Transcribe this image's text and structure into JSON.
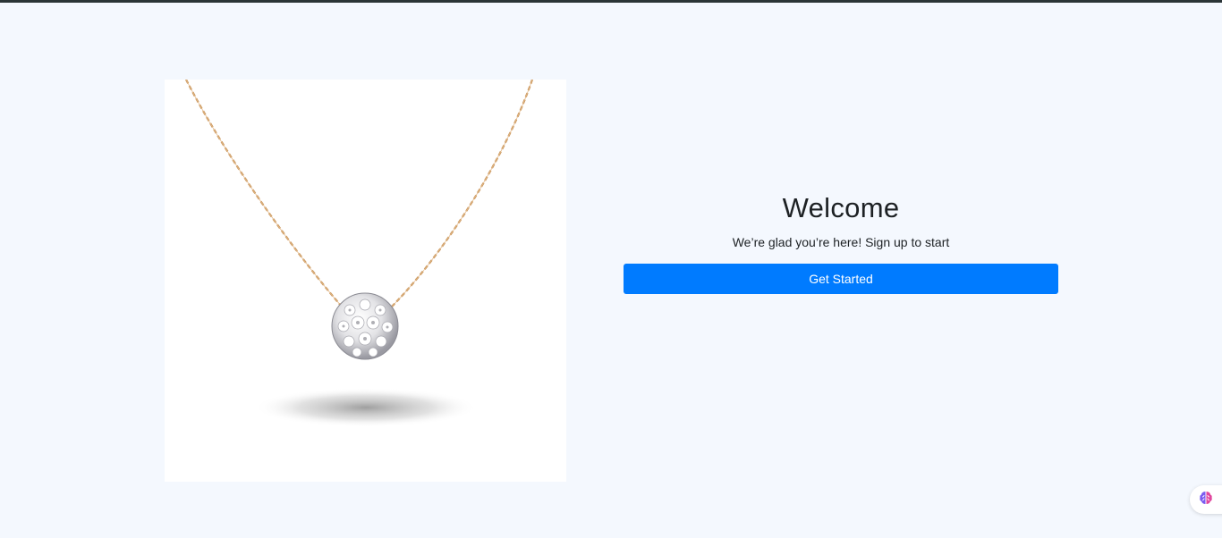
{
  "hero": {
    "image_subject": "necklace-with-crystal-ball-pendant"
  },
  "welcome": {
    "title": "Welcome",
    "subtitle": "We’re glad you’re here! Sign up to start",
    "cta_label": "Get Started"
  },
  "widget": {
    "icon": "brain-icon"
  },
  "colors": {
    "page_background": "#f4f8fe",
    "top_bar": "#2b3537",
    "primary_button": "#007bff",
    "text": "#1d2124",
    "chain_gold": "#c8955a"
  }
}
